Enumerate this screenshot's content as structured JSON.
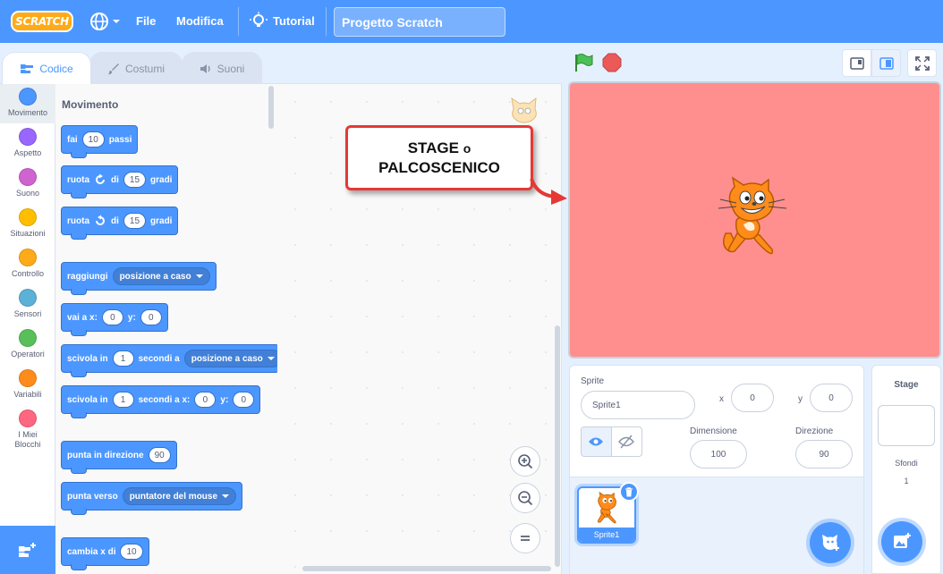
{
  "menubar": {
    "logo_text": "SCRATCH",
    "file_label": "File",
    "edit_label": "Modifica",
    "tutorial_label": "Tutorial",
    "project_title": "Progetto Scratch"
  },
  "tabs": {
    "code": "Codice",
    "costumes": "Costumi",
    "sounds": "Suoni"
  },
  "categories": [
    {
      "label": "Movimento",
      "color": "#4c97ff"
    },
    {
      "label": "Aspetto",
      "color": "#9966ff"
    },
    {
      "label": "Suono",
      "color": "#cf63cf"
    },
    {
      "label": "Situazioni",
      "color": "#ffbf00"
    },
    {
      "label": "Controllo",
      "color": "#ffab19"
    },
    {
      "label": "Sensori",
      "color": "#5cb1d6"
    },
    {
      "label": "Operatori",
      "color": "#59c059"
    },
    {
      "label": "Variabili",
      "color": "#ff8c1a"
    },
    {
      "label": "I Miei Blocchi",
      "color": "#ff6680"
    }
  ],
  "palette": {
    "heading": "Movimento",
    "blocks": {
      "move": {
        "pre": "fai",
        "value": "10",
        "post": "passi"
      },
      "turn_right": {
        "pre": "ruota",
        "mid": "di",
        "value": "15",
        "post": "gradi"
      },
      "turn_left": {
        "pre": "ruota",
        "mid": "di",
        "value": "15",
        "post": "gradi"
      },
      "goto": {
        "pre": "raggiungi",
        "option": "posizione a caso"
      },
      "goto_xy": {
        "pre": "vai a x:",
        "x": "0",
        "ylabel": "y:",
        "y": "0"
      },
      "glide": {
        "pre": "scivola in",
        "value": "1",
        "mid": "secondi a",
        "option": "posizione a caso"
      },
      "glide_xy": {
        "pre": "scivola in",
        "value": "1",
        "mid": "secondi a x:",
        "x": "0",
        "ylabel": "y:",
        "y": "0"
      },
      "point_dir": {
        "pre": "punta in direzione",
        "value": "90"
      },
      "point_to": {
        "pre": "punta verso",
        "option": "puntatore del mouse"
      },
      "change_x": {
        "pre": "cambia x di",
        "value": "10"
      }
    }
  },
  "callout": {
    "line1_strong": "STAGE",
    "line1_small": "o",
    "line2": "PALCOSCENICO"
  },
  "sprite_info": {
    "sprite_label": "Sprite",
    "sprite_name": "Sprite1",
    "x_label": "x",
    "x_value": "0",
    "y_label": "y",
    "y_value": "0",
    "size_label": "Dimensione",
    "size_value": "100",
    "direction_label": "Direzione",
    "direction_value": "90",
    "thumb_label": "Sprite1"
  },
  "stage_pane": {
    "title": "Stage",
    "backdrops_label": "Sfondi",
    "backdrops_count": "1"
  },
  "colors": {
    "accent": "#4c97ff",
    "stage_background": "#ff8f8f",
    "callout_border": "#e53935"
  }
}
